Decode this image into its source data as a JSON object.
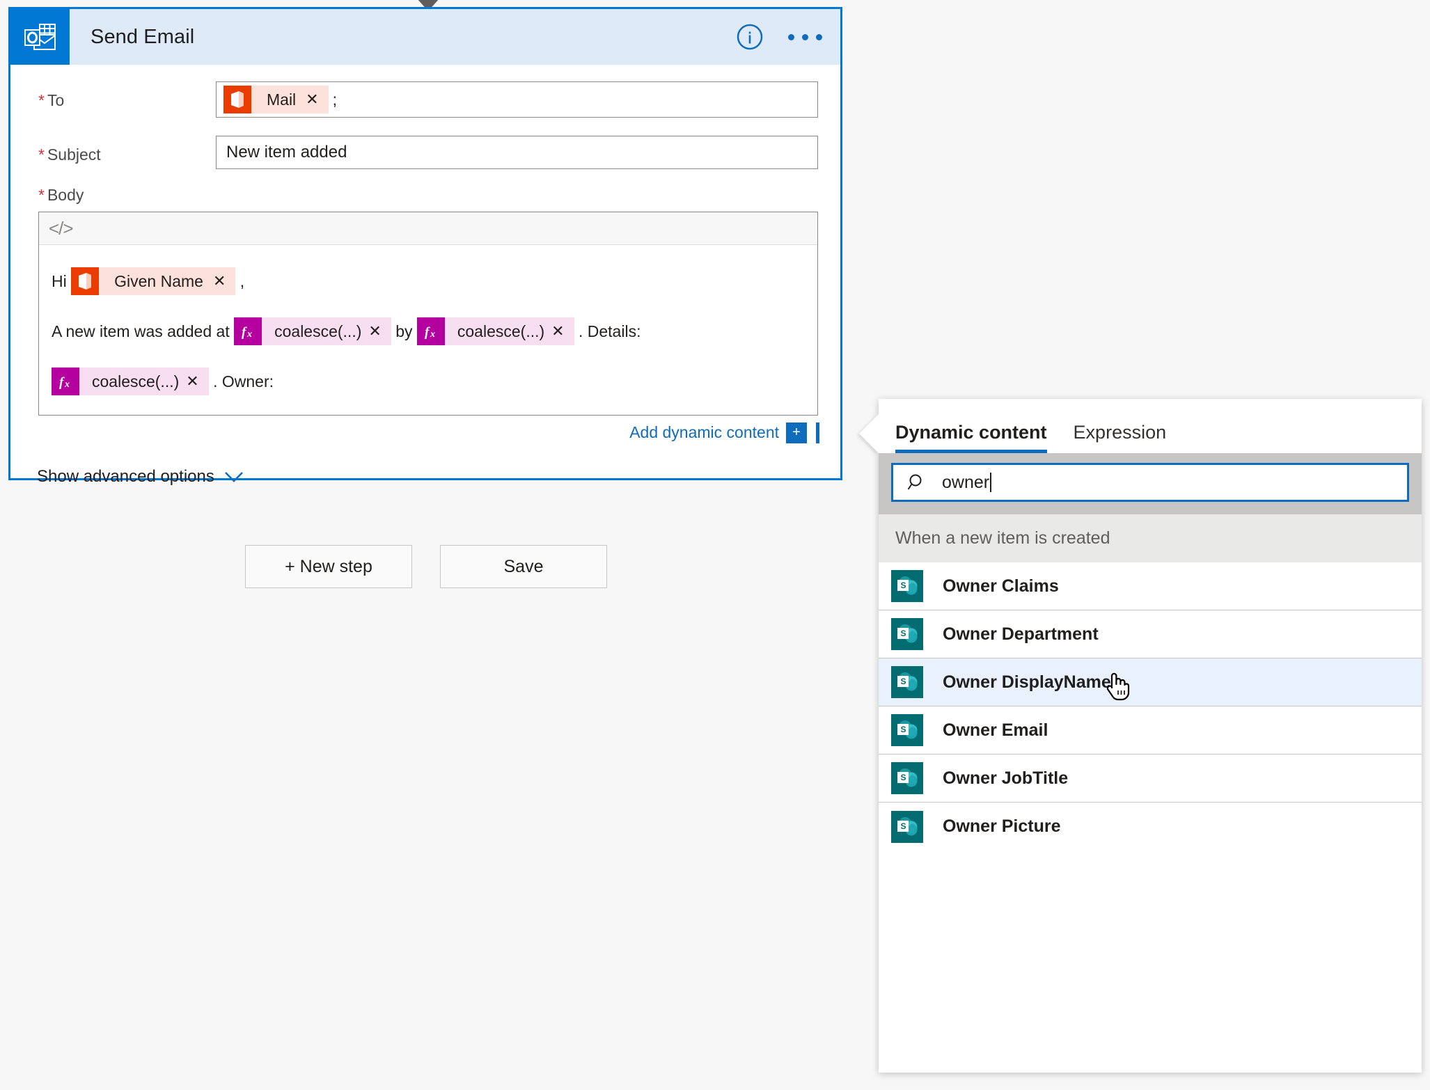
{
  "action_card": {
    "title": "Send Email",
    "icon_name": "office365-outlook-icon",
    "info_icon": "info-circle-icon",
    "more_icon": "ellipsis-icon",
    "fields": {
      "to": {
        "label": "To",
        "required_marker": "*",
        "token": {
          "label": "Mail",
          "icon": "office-365-icon",
          "remove": "✕"
        },
        "trailing_text": ";"
      },
      "subject": {
        "label": "Subject",
        "required_marker": "*",
        "value": "New item added"
      },
      "body": {
        "label": "Body",
        "required_marker": "*",
        "toolbar_icon": "code-view-icon",
        "line1": {
          "before": "Hi",
          "token": {
            "label": "Given Name",
            "icon": "office-365-icon",
            "remove": "✕"
          },
          "after": ","
        },
        "line2": {
          "before": "A new item was added at",
          "token1": {
            "label": "coalesce(...)",
            "icon": "fx-icon",
            "remove": "✕"
          },
          "middle": "by",
          "token2": {
            "label": "coalesce(...)",
            "icon": "fx-icon",
            "remove": "✕"
          },
          "after": ". Details:"
        },
        "line3": {
          "token": {
            "label": "coalesce(...)",
            "icon": "fx-icon",
            "remove": "✕"
          },
          "after": ". Owner:"
        }
      }
    },
    "add_dynamic_content": {
      "label": "Add dynamic content",
      "plus_label": "+"
    },
    "show_advanced_options": {
      "label": "Show advanced options",
      "chevron": "chevron-down-icon"
    }
  },
  "footer_buttons": {
    "new_step": "+ New step",
    "save": "Save"
  },
  "dynamic_content_panel": {
    "tabs": [
      {
        "label": "Dynamic content",
        "active": true
      },
      {
        "label": "Expression",
        "active": false
      }
    ],
    "search": {
      "value": "owner",
      "placeholder": "Search dynamic content",
      "icon": "search-icon"
    },
    "group_header": "When a new item is created",
    "items": [
      {
        "label": "Owner Claims",
        "icon": "sharepoint-icon",
        "selected": false
      },
      {
        "label": "Owner Department",
        "icon": "sharepoint-icon",
        "selected": false
      },
      {
        "label": "Owner DisplayName",
        "icon": "sharepoint-icon",
        "selected": true
      },
      {
        "label": "Owner Email",
        "icon": "sharepoint-icon",
        "selected": false
      },
      {
        "label": "Owner JobTitle",
        "icon": "sharepoint-icon",
        "selected": false
      },
      {
        "label": "Owner Picture",
        "icon": "sharepoint-icon",
        "selected": false
      }
    ]
  },
  "colors": {
    "accent_blue": "#0078d4",
    "link_blue": "#0f6cbd",
    "header_bg": "#deeaf8",
    "token_orange": "#eb3c00",
    "token_orange_bg": "#fde2dc",
    "token_magenta": "#b4009e",
    "token_magenta_bg": "#f7dff1",
    "sharepoint_teal": "#036c70",
    "required_red": "#d13438",
    "selected_row": "#e8f1fc"
  }
}
